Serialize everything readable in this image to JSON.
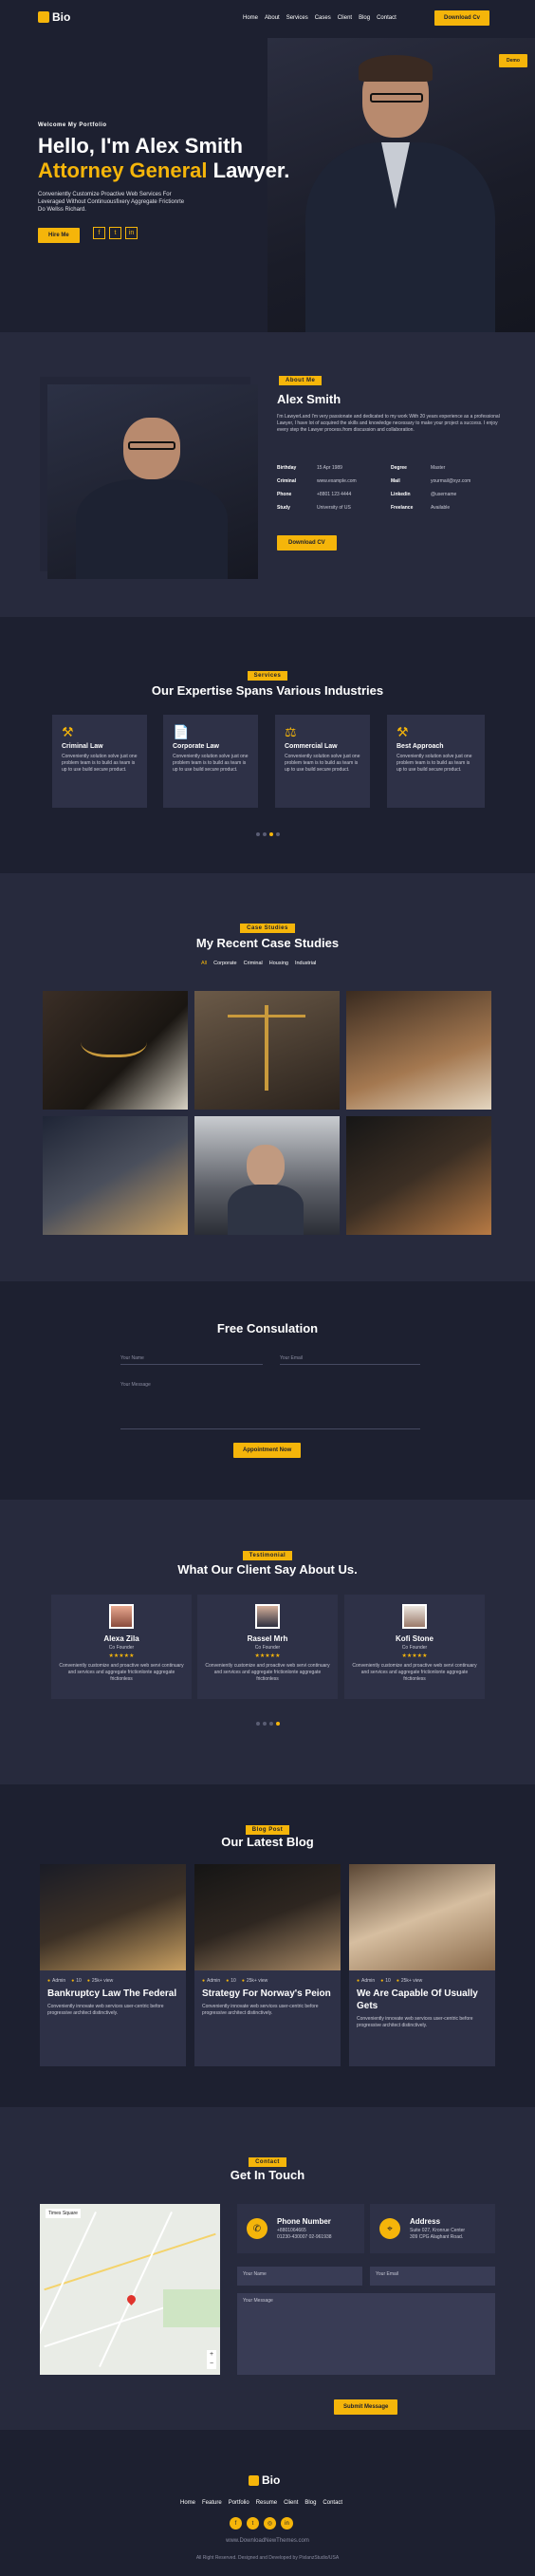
{
  "colors": {
    "accent": "#f5b50a",
    "bg": "#272a3d",
    "bg_dark": "#1d2030",
    "card": "#2e3147"
  },
  "header": {
    "logo": "Bio",
    "nav": [
      "Home",
      "About",
      "Services",
      "Cases",
      "Client",
      "Blog",
      "Contact"
    ],
    "download": "Download Cv"
  },
  "hero": {
    "demo": "Demo",
    "welcome": "Welcome My Portfolio",
    "hello": "Hello, I'm Alex Smith",
    "role": "Attorney General",
    "role_suffix": "Lawyer.",
    "desc": "Conveniently Customize Proactive Web Services For Leveraged Without Continuousfixery Aggregate Frictionrte Do Wellss Richard.",
    "hire": "Hire Me",
    "social": [
      "f-icon",
      "twitter-icon",
      "linkedin-icon"
    ]
  },
  "about": {
    "badge": "About Me",
    "name": "Alex Smith",
    "bio": "I'm LawyerLand I'm very passionate and dedicated to my work With 20 years experience as a professional Lawyer, I have lot of acquired the skills and knowledge necessary to make your project a success. I enjoy every step the Lawyer process.from discussion and collaboration.",
    "rows": [
      [
        "Birthday",
        "15 Apr 1989",
        "Degree",
        "Master"
      ],
      [
        "Criminal",
        "www.example.com",
        "Mail",
        "yourmail@xyz.com"
      ],
      [
        "Phone",
        "+8801 123 4444",
        "Linkedin",
        "@username"
      ],
      [
        "Study",
        "University of US",
        "Freelance",
        "Available"
      ]
    ],
    "download": "Download CV"
  },
  "services": {
    "badge": "Services",
    "title": "Our Expertise Spans Various Industries",
    "items": [
      {
        "icon": "gavel-icon",
        "title": "Criminal Law",
        "text": "Conveniently solution solve just one problem team is to build as team is up to use build secure product."
      },
      {
        "icon": "document-icon",
        "title": "Corporate Law",
        "text": "Conveniently solution solve just one problem team is to build as team is up to use build secure product."
      },
      {
        "icon": "scales-icon",
        "title": "Commercial Law",
        "text": "Conveniently solution solve just one problem team is to build as team is up to use build secure product."
      },
      {
        "icon": "gavel-icon",
        "title": "Best Approach",
        "text": "Conveniently solution solve just one problem team is to build as team is up to use build secure product."
      }
    ]
  },
  "cases": {
    "badge": "Case Studies",
    "title": "My Recent Case Studies",
    "filters": [
      "All",
      "Corporate",
      "Criminal",
      "Housing",
      "Industrial"
    ]
  },
  "consult": {
    "title": "Free Consulation",
    "name_ph": "Your Name",
    "email_ph": "Your Email",
    "msg_ph": "Your Message",
    "button": "Appointment Now"
  },
  "testimonial": {
    "badge": "Testimonial",
    "title": "What Our Client Say About Us.",
    "items": [
      {
        "name": "Alexa Zila",
        "role": "Co Founder",
        "text": "Conveniently customize and proactive web servi continuary and services and aggregate frictionlonte aggregate frictionless"
      },
      {
        "name": "Rassel Mrh",
        "role": "Co Founder",
        "text": "Conveniently customize and proactive web servi continuary and services and aggregate frictionlonte aggregate frictionless"
      },
      {
        "name": "Kofi Stone",
        "role": "Co Founder",
        "text": "Conveniently customize and proactive web servi continuary and services and aggregate frictionlonte aggregate frictionless"
      }
    ],
    "stars": "★★★★★"
  },
  "blog": {
    "badge": "Blog Post",
    "title": "Our Latest Blog",
    "meta": [
      "Admin",
      "10",
      "25k+ view"
    ],
    "items": [
      {
        "title": "Bankruptcy Law The Federal",
        "text": "Conveniently innovate web services user-centric before progressive architect distinctively."
      },
      {
        "title": "Strategy For Norway's Peion",
        "text": "Conveniently innovate web services user-centric before progressive architect distinctively."
      },
      {
        "title": "We Are Capable Of Usually Gets",
        "text": "Conveniently innovate web services user-centric before progressive architect distinctively."
      }
    ]
  },
  "contact": {
    "badge": "Contact",
    "title": "Get In Touch",
    "phone_title": "Phone Number",
    "phone_lines": [
      "+8801064665",
      "01230-430007 02-961938"
    ],
    "address_title": "Address",
    "address_lines": [
      "Suite 027, Kronrue Center",
      "309 CPG Alaghant Road."
    ],
    "name_ph": "Your Name",
    "email_ph": "Your Email",
    "msg_ph": "Your Message",
    "submit": "Submit Message",
    "map_label": "Times Square"
  },
  "footer": {
    "logo": "Bio",
    "nav": [
      "Home",
      "Feature",
      "Portfolio",
      "Resume",
      "Client",
      "Blog",
      "Contact"
    ],
    "site": "www.DownloadNewThemes.com",
    "copyright": "All Right Reserved. Designed and Developed by PixlanzStudio/USA"
  }
}
